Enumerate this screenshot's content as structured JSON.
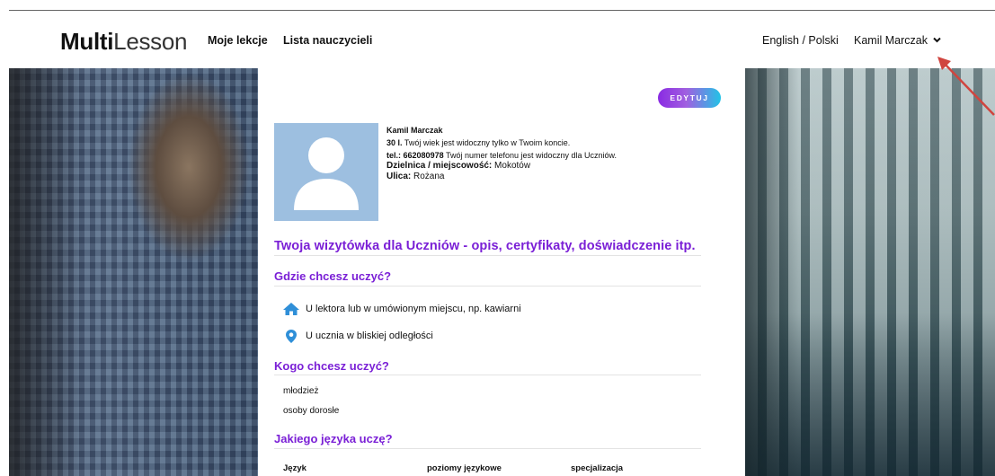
{
  "header": {
    "logo_bold": "Multi",
    "logo_thin": "Lesson",
    "nav_links": [
      "Moje lekcje",
      "Lista nauczycieli"
    ],
    "language_switch": "English / Polski",
    "user_menu": "Kamil Marczak"
  },
  "profile": {
    "edit_label": "EDYTUJ",
    "name": "Kamil Marczak",
    "age_value": "30 l.",
    "age_note": "Twój wiek jest widoczny tylko w Twoim koncie.",
    "phone_label": "tel.:",
    "phone_value": "662080978",
    "phone_note": "Twój numer telefonu jest widoczny dla Uczniów.",
    "district_label": "Dzielnica / miejscowość:",
    "district_value": "Mokotów",
    "street_label": "Ulica:",
    "street_value": "Rożana"
  },
  "sections": {
    "bio_title": "Twoja wizytówka dla Uczniów - opis, certyfikaty, doświadczenie itp.",
    "where_title": "Gdzie chcesz uczyć?",
    "where_items": [
      {
        "icon": "home-icon",
        "label": "U lektora lub w umówionym miejscu, np. kawiarni"
      },
      {
        "icon": "location-pin-icon",
        "label": "U ucznia w bliskiej odległości"
      }
    ],
    "whom_title": "Kogo chcesz uczyć?",
    "whom_items": [
      "młodzież",
      "osoby dorosłe"
    ],
    "language_title": "Jakiego języka uczę?",
    "language_table_headers": [
      "Język",
      "poziomy językowe",
      "specjalizacja"
    ]
  },
  "colors": {
    "accent_purple": "#7a1fd6",
    "edit_gradient_start": "#8a2be2",
    "edit_gradient_end": "#22c3e6",
    "icon_blue": "#2f8fd8",
    "avatar_bg": "#9dbfe0",
    "annotation_arrow": "#d0453f"
  }
}
